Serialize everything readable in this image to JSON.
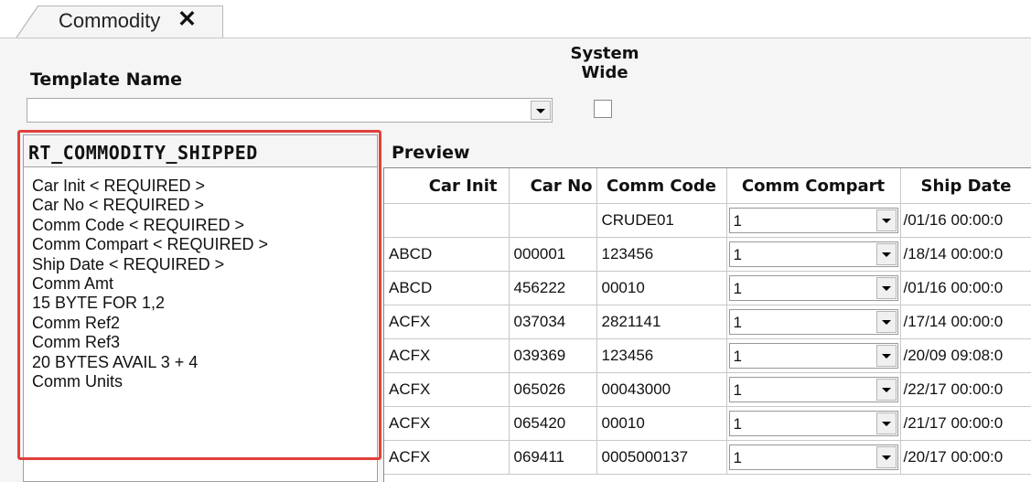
{
  "tab": {
    "label": "Commodity",
    "close_glyph": "✕"
  },
  "template": {
    "label": "Template Name",
    "value": ""
  },
  "system_wide": {
    "label": "System Wide",
    "checked": false
  },
  "fields": {
    "header": "RT_COMMODITY_SHIPPED",
    "items": [
      "Car Init < REQUIRED >",
      "Car No < REQUIRED >",
      "Comm Code < REQUIRED >",
      "Comm Compart < REQUIRED >",
      "Ship Date < REQUIRED >",
      "Comm Amt",
      "15 BYTE FOR 1,2",
      "Comm Ref2",
      "Comm Ref3",
      "20 BYTES AVAIL 3 + 4",
      "Comm Units"
    ]
  },
  "preview": {
    "label": "Preview",
    "columns": [
      "Car Init",
      "Car No",
      "Comm Code",
      "Comm Compart",
      "Ship Date"
    ],
    "rows": [
      {
        "car_init": "",
        "car_no": "",
        "comm_code": "CRUDE01",
        "comm_compart": "1",
        "ship_date": "/01/16 00:00:0"
      },
      {
        "car_init": "ABCD",
        "car_no": "000001",
        "comm_code": "123456",
        "comm_compart": "1",
        "ship_date": "/18/14 00:00:0"
      },
      {
        "car_init": "ABCD",
        "car_no": "456222",
        "comm_code": "00010",
        "comm_compart": "1",
        "ship_date": "/01/16 00:00:0"
      },
      {
        "car_init": "ACFX",
        "car_no": "037034",
        "comm_code": "2821141",
        "comm_compart": "1",
        "ship_date": "/17/14 00:00:0"
      },
      {
        "car_init": "ACFX",
        "car_no": "039369",
        "comm_code": "123456",
        "comm_compart": "1",
        "ship_date": "/20/09 09:08:0"
      },
      {
        "car_init": "ACFX",
        "car_no": "065026",
        "comm_code": "00043000",
        "comm_compart": "1",
        "ship_date": "/22/17 00:00:0"
      },
      {
        "car_init": "ACFX",
        "car_no": "065420",
        "comm_code": "00010",
        "comm_compart": "1",
        "ship_date": "/21/17 00:00:0"
      },
      {
        "car_init": "ACFX",
        "car_no": "069411",
        "comm_code": "0005000137",
        "comm_compart": "1",
        "ship_date": "/20/17 00:00:0"
      }
    ]
  },
  "icons": {
    "tab_close": "close-icon",
    "dropdown": "chevron-down-icon"
  },
  "colors": {
    "highlight": "#e0413b",
    "background": "#f5f5f5"
  }
}
